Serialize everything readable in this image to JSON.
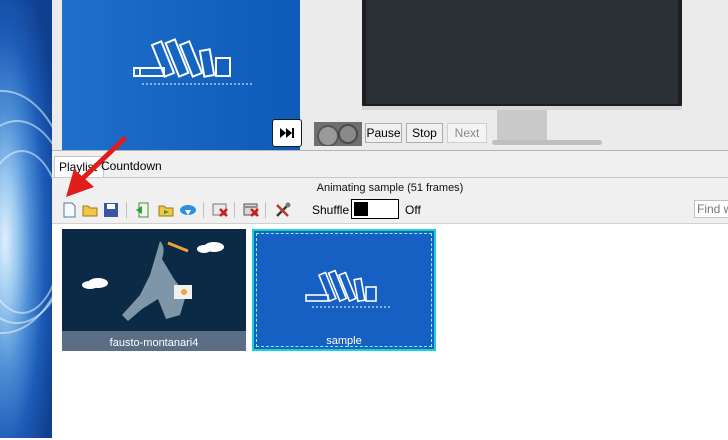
{
  "preview": {
    "controls": {
      "pause_label": "Pause",
      "stop_label": "Stop",
      "next_label": "Next"
    }
  },
  "tabs": [
    {
      "label": "Playlist"
    },
    {
      "label": "Countdown"
    }
  ],
  "status_text": "Animating sample  (51 frames)",
  "toolbar": {
    "shuffle_label": "Shuffle",
    "shuffle_state": "Off",
    "find_placeholder": "Find w"
  },
  "playlist_items": [
    {
      "caption": "fausto-montanari4"
    },
    {
      "caption": "sample"
    }
  ],
  "colors": {
    "accent_red": "#e21b1b",
    "selection_cyan": "#1ed0d0",
    "wallpaper_blue": "#1565c0"
  }
}
